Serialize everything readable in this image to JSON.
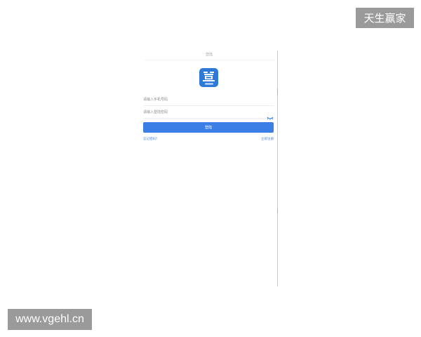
{
  "watermarks": {
    "top_right": "天生赢家",
    "bottom_left": "www.vgehl.cn"
  },
  "login": {
    "title": "登陆",
    "logo_icon": "app-logo-icon",
    "phone_placeholder": "请输入手机号码",
    "password_placeholder": "请输入登陆密码",
    "eye_icon": "eye-icon",
    "login_button": "登陆",
    "forgot_link": "忘记密码?",
    "register_link": "立即注册"
  },
  "colors": {
    "accent": "#3b7fe6",
    "logo": "#2f7ad9",
    "link": "#4a86e0",
    "watermark_bg": "#9a9a9a"
  }
}
